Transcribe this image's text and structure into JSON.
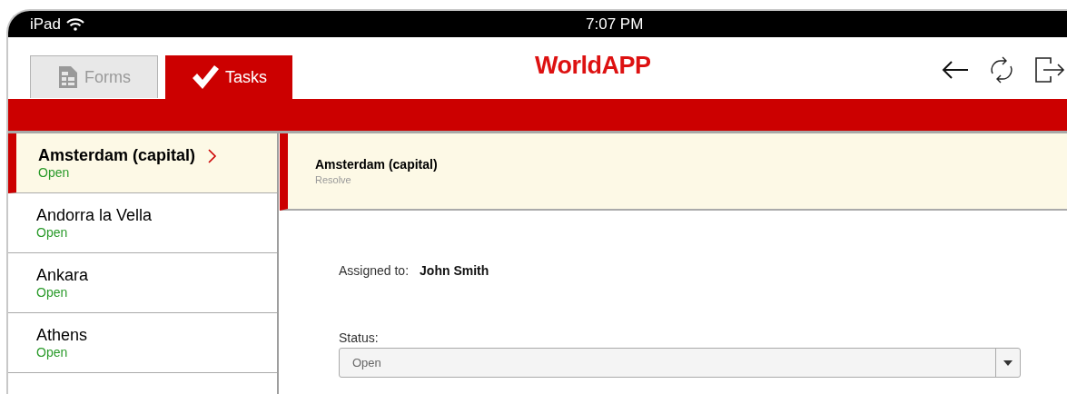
{
  "status_bar": {
    "device": "iPad",
    "time": "7:07 PM"
  },
  "tabs": [
    {
      "label": "Forms",
      "kind": "forms",
      "selected": false
    },
    {
      "label": "Tasks",
      "kind": "tasks",
      "selected": true
    }
  ],
  "logo": "WorldAPP",
  "tasks": [
    {
      "name": "Amsterdam (capital)",
      "status": "Open",
      "selected": true
    },
    {
      "name": "Andorra la Vella",
      "status": "Open",
      "selected": false
    },
    {
      "name": "Ankara",
      "status": "Open",
      "selected": false
    },
    {
      "name": "Athens",
      "status": "Open",
      "selected": false
    }
  ],
  "detail": {
    "title": "Amsterdam (capital)",
    "subtitle": "Resolve",
    "assigned_label": "Assigned to:",
    "assigned_value": "John Smith",
    "status_label": "Status:",
    "status_value": "Open"
  }
}
